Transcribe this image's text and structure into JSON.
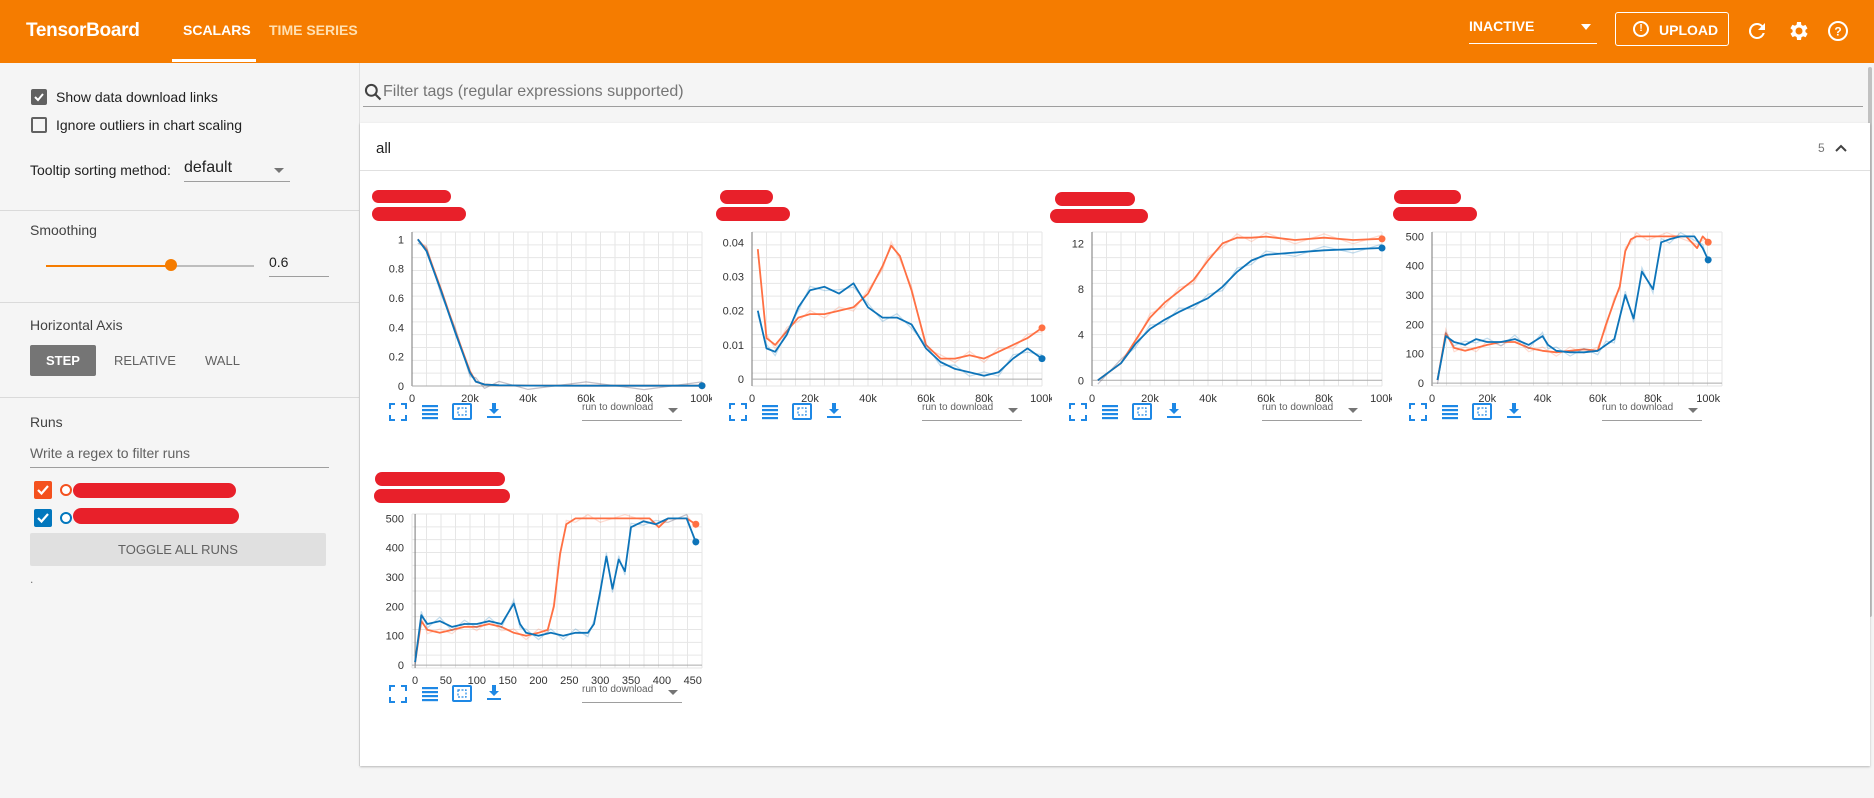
{
  "header": {
    "brand": "TensorBoard",
    "tabs": [
      {
        "label": "SCALARS",
        "active": true
      },
      {
        "label": "TIME SERIES",
        "active": false
      }
    ],
    "status_select": "INACTIVE",
    "upload_label": "UPLOAD",
    "icons": [
      "refresh-icon",
      "settings-icon",
      "help-icon"
    ]
  },
  "sidebar": {
    "show_download_links": {
      "label": "Show data download links",
      "checked": true
    },
    "ignore_outliers": {
      "label": "Ignore outliers in chart scaling",
      "checked": false
    },
    "tooltip_sorting": {
      "label": "Tooltip sorting method:",
      "value": "default"
    },
    "smoothing": {
      "title": "Smoothing",
      "value": "0.6",
      "fraction": 0.6
    },
    "horizontal_axis": {
      "title": "Horizontal Axis",
      "options": [
        "STEP",
        "RELATIVE",
        "WALL"
      ],
      "selected": "STEP"
    },
    "runs": {
      "title": "Runs",
      "filter_placeholder": "Write a regex to filter runs",
      "items": [
        {
          "color": "#f4511e",
          "checked": true
        },
        {
          "color": "#0277bd",
          "checked": true
        }
      ],
      "toggle_label": "TOGGLE ALL RUNS",
      "footnote": "."
    }
  },
  "main": {
    "filter_placeholder": "Filter tags (regular expressions supported)",
    "group": {
      "title": "all",
      "count": "5"
    },
    "download_select_label": "run to download"
  },
  "colors": {
    "accent": "#f57c00",
    "run_orange": "#ff7043",
    "run_blue": "#0d74b9"
  },
  "chart_data": [
    {
      "type": "line",
      "title": "",
      "xlim": [
        0,
        100000
      ],
      "ylim": [
        0,
        1.05
      ],
      "x_ticks": [
        "0",
        "20k",
        "40k",
        "60k",
        "80k",
        "100k"
      ],
      "x_tick_values": [
        0,
        20000,
        40000,
        60000,
        80000,
        100000
      ],
      "y_ticks": [
        "0",
        "0.2",
        "0.4",
        "0.6",
        "0.8",
        "1"
      ],
      "y_tick_values": [
        0,
        0.2,
        0.4,
        0.6,
        0.8,
        1
      ],
      "series": [
        {
          "color": "#ff7043",
          "x": [
            2000,
            5000,
            10000,
            15000,
            20000,
            22000,
            25000,
            30000,
            40000,
            60000,
            80000,
            100000
          ],
          "values": [
            1,
            0.93,
            0.66,
            0.37,
            0.1,
            0.03,
            0.01,
            0.005,
            0.003,
            0.002,
            0.002,
            0.002
          ]
        },
        {
          "color": "#0d74b9",
          "x": [
            2000,
            5000,
            10000,
            15000,
            20000,
            22000,
            25000,
            30000,
            40000,
            60000,
            80000,
            100000
          ],
          "values": [
            1,
            0.92,
            0.65,
            0.36,
            0.09,
            0.03,
            0.01,
            0.005,
            0.003,
            0.002,
            0.002,
            0.002
          ]
        }
      ]
    },
    {
      "type": "line",
      "title": "",
      "xlim": [
        0,
        100000
      ],
      "ylim": [
        -0.002,
        0.043
      ],
      "x_ticks": [
        "0",
        "20k",
        "40k",
        "60k",
        "80k",
        "100k"
      ],
      "x_tick_values": [
        0,
        20000,
        40000,
        60000,
        80000,
        100000
      ],
      "y_ticks": [
        "0",
        "0.01",
        "0.02",
        "0.03",
        "0.04"
      ],
      "y_tick_values": [
        0,
        0.01,
        0.02,
        0.03,
        0.04
      ],
      "series": [
        {
          "color": "#ff7043",
          "x": [
            2000,
            5000,
            8000,
            12000,
            16000,
            20000,
            25000,
            30000,
            35000,
            40000,
            45000,
            48000,
            51000,
            55000,
            60000,
            65000,
            70000,
            75000,
            80000,
            85000,
            90000,
            95000,
            100000
          ],
          "values": [
            0.038,
            0.012,
            0.01,
            0.014,
            0.018,
            0.019,
            0.019,
            0.02,
            0.021,
            0.025,
            0.033,
            0.039,
            0.036,
            0.026,
            0.01,
            0.006,
            0.006,
            0.007,
            0.006,
            0.008,
            0.01,
            0.012,
            0.015
          ]
        },
        {
          "color": "#0d74b9",
          "x": [
            2000,
            5000,
            8000,
            12000,
            16000,
            20000,
            25000,
            30000,
            35000,
            40000,
            45000,
            50000,
            55000,
            60000,
            65000,
            70000,
            75000,
            80000,
            85000,
            90000,
            95000,
            100000
          ],
          "values": [
            0.02,
            0.009,
            0.008,
            0.013,
            0.021,
            0.026,
            0.027,
            0.025,
            0.028,
            0.021,
            0.018,
            0.018,
            0.016,
            0.009,
            0.005,
            0.003,
            0.002,
            0.001,
            0.002,
            0.006,
            0.009,
            0.006
          ]
        }
      ]
    },
    {
      "type": "line",
      "title": "",
      "xlim": [
        0,
        100000
      ],
      "ylim": [
        -0.5,
        13
      ],
      "x_ticks": [
        "0",
        "20k",
        "40k",
        "60k",
        "80k",
        "100k"
      ],
      "x_tick_values": [
        0,
        20000,
        40000,
        60000,
        80000,
        100000
      ],
      "y_ticks": [
        "0",
        "4",
        "8",
        "12"
      ],
      "y_tick_values": [
        0,
        4,
        8,
        12
      ],
      "series": [
        {
          "color": "#ff7043",
          "x": [
            2000,
            10000,
            15000,
            20000,
            25000,
            30000,
            35000,
            40000,
            45000,
            50000,
            55000,
            60000,
            70000,
            80000,
            90000,
            100000
          ],
          "values": [
            0,
            1.5,
            3.5,
            5.5,
            6.8,
            7.8,
            8.8,
            10.5,
            12,
            12.5,
            12.5,
            12.6,
            12.3,
            12.5,
            12.3,
            12.4
          ]
        },
        {
          "color": "#0d74b9",
          "x": [
            2000,
            10000,
            15000,
            20000,
            25000,
            30000,
            35000,
            40000,
            45000,
            50000,
            55000,
            60000,
            70000,
            80000,
            90000,
            100000
          ],
          "values": [
            0,
            1.5,
            3.2,
            4.5,
            5.3,
            6,
            6.6,
            7.2,
            8.2,
            9.5,
            10.5,
            11,
            11.2,
            11.4,
            11.5,
            11.6
          ]
        }
      ]
    },
    {
      "type": "line",
      "title": "",
      "xlim": [
        0,
        105000
      ],
      "ylim": [
        -10,
        515
      ],
      "x_ticks": [
        "0",
        "20k",
        "40k",
        "60k",
        "80k",
        "100k"
      ],
      "x_tick_values": [
        0,
        20000,
        40000,
        60000,
        80000,
        100000
      ],
      "y_ticks": [
        "0",
        "100",
        "200",
        "300",
        "400",
        "500"
      ],
      "y_tick_values": [
        0,
        100,
        200,
        300,
        400,
        500
      ],
      "series": [
        {
          "color": "#ff7043",
          "x": [
            2000,
            5000,
            8000,
            12000,
            16000,
            20000,
            25000,
            30000,
            35000,
            40000,
            45000,
            50000,
            55000,
            60000,
            63000,
            66000,
            68000,
            70000,
            72000,
            74000,
            78000,
            85000,
            92000,
            96000,
            98000,
            100000
          ],
          "values": [
            10,
            170,
            120,
            110,
            120,
            130,
            140,
            140,
            120,
            110,
            105,
            110,
            115,
            110,
            200,
            280,
            330,
            450,
            490,
            500,
            500,
            500,
            500,
            460,
            500,
            480
          ]
        },
        {
          "color": "#0d74b9",
          "x": [
            2000,
            5000,
            8000,
            12000,
            16000,
            20000,
            25000,
            30000,
            35000,
            40000,
            42000,
            45000,
            50000,
            55000,
            60000,
            63000,
            66000,
            70000,
            73000,
            76000,
            80000,
            83000,
            86000,
            90000,
            95000,
            98000,
            100000
          ],
          "values": [
            10,
            160,
            140,
            130,
            150,
            140,
            140,
            150,
            130,
            160,
            130,
            110,
            105,
            105,
            110,
            130,
            150,
            300,
            220,
            380,
            320,
            480,
            490,
            500,
            500,
            460,
            420
          ]
        }
      ]
    },
    {
      "type": "line",
      "title": "",
      "xlim": [
        -5,
        465
      ],
      "ylim": [
        -10,
        515
      ],
      "x_ticks": [
        "0",
        "50",
        "100",
        "150",
        "200",
        "250",
        "300",
        "350",
        "400",
        "450"
      ],
      "x_tick_values": [
        0,
        50,
        100,
        150,
        200,
        250,
        300,
        350,
        400,
        450
      ],
      "y_ticks": [
        "0",
        "100",
        "200",
        "300",
        "400",
        "500"
      ],
      "y_tick_values": [
        0,
        100,
        200,
        300,
        400,
        500
      ],
      "series": [
        {
          "color": "#ff7043",
          "x": [
            0,
            10,
            20,
            40,
            60,
            80,
            100,
            120,
            140,
            160,
            180,
            200,
            215,
            225,
            235,
            245,
            260,
            280,
            300,
            340,
            380,
            395,
            410,
            440,
            455
          ],
          "values": [
            10,
            150,
            120,
            110,
            120,
            130,
            130,
            140,
            130,
            110,
            100,
            110,
            120,
            200,
            380,
            480,
            500,
            500,
            500,
            500,
            500,
            470,
            500,
            500,
            480
          ]
        },
        {
          "color": "#0d74b9",
          "x": [
            0,
            10,
            20,
            40,
            60,
            80,
            100,
            120,
            140,
            160,
            170,
            180,
            200,
            220,
            240,
            260,
            280,
            290,
            300,
            310,
            320,
            330,
            340,
            350,
            370,
            390,
            410,
            440,
            455
          ],
          "values": [
            10,
            170,
            140,
            150,
            130,
            140,
            140,
            150,
            140,
            210,
            140,
            110,
            100,
            110,
            100,
            110,
            110,
            140,
            250,
            370,
            260,
            360,
            320,
            470,
            490,
            480,
            500,
            500,
            420
          ]
        }
      ]
    }
  ]
}
